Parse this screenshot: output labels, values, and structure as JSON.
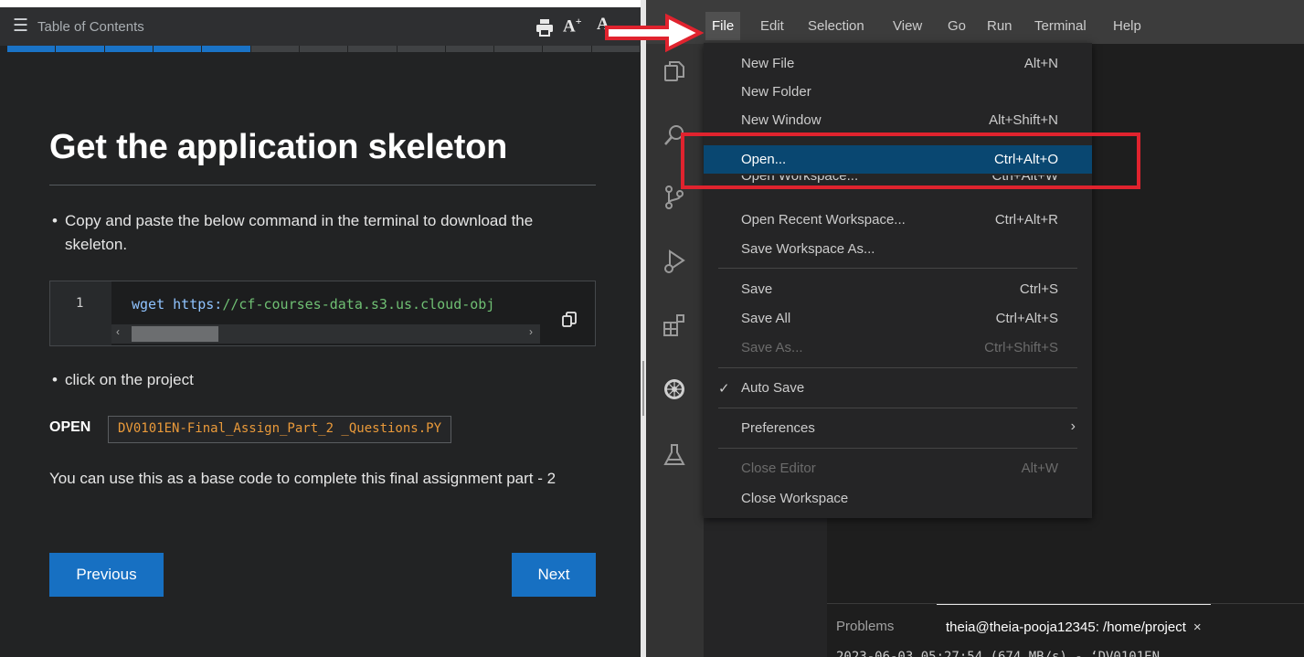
{
  "lab": {
    "toc_title": "Table of Contents",
    "font_increase": "A",
    "font_decrease": "A",
    "progress": {
      "total_segments": 13,
      "completed_segments": 5
    },
    "page_title": "Get the application skeleton",
    "bullet_1": "Copy and paste the below command in the terminal to download the skeleton.",
    "code": {
      "line_number": "1",
      "command": "wget",
      "url_scheme": "https:",
      "url_rest": "//cf-courses-data.s3.us.cloud-obj"
    },
    "bullet_2": "click on the project",
    "open_label": "OPEN",
    "open_filename": "DV0101EN-Final_Assign_Part_2 _Questions.PY",
    "description": "You can use this as a base code to complete this final assignment part - 2",
    "previous_label": "Previous",
    "next_label": "Next"
  },
  "ide": {
    "menubar": [
      "File",
      "Edit",
      "Selection",
      "View",
      "Go",
      "Run",
      "Terminal",
      "Help"
    ],
    "file_menu": {
      "new_file": {
        "label": "New File",
        "shortcut": "Alt+N"
      },
      "new_folder": {
        "label": "New Folder",
        "shortcut": ""
      },
      "new_window": {
        "label": "New Window",
        "shortcut": "Alt+Shift+N"
      },
      "open": {
        "label": "Open...",
        "shortcut": "Ctrl+Alt+O"
      },
      "open_workspace": {
        "label": "Open Workspace...",
        "shortcut": "Ctrl+Alt+W"
      },
      "open_recent": {
        "label": "Open Recent Workspace...",
        "shortcut": "Ctrl+Alt+R"
      },
      "save_workspace_as": {
        "label": "Save Workspace As...",
        "shortcut": ""
      },
      "save": {
        "label": "Save",
        "shortcut": "Ctrl+S"
      },
      "save_all": {
        "label": "Save All",
        "shortcut": "Ctrl+Alt+S"
      },
      "save_as": {
        "label": "Save As...",
        "shortcut": "Ctrl+Shift+S"
      },
      "auto_save": {
        "label": "Auto Save",
        "check": "✓"
      },
      "preferences": {
        "label": "Preferences",
        "chevron": "›"
      },
      "close_editor": {
        "label": "Close Editor",
        "shortcut": "Alt+W"
      },
      "close_workspace": {
        "label": "Close Workspace",
        "shortcut": ""
      }
    },
    "panel": {
      "problems_tab": "Problems",
      "terminal_tab": "theia@theia-pooja12345: /home/project",
      "terminal_close": "×",
      "terminal_output": "2023-06-03 05:27:54 (674 MB/s) - ‘DV0101EN"
    }
  },
  "colors": {
    "accent": "#1770c2",
    "annotation": "#e0232e",
    "menu_selected": "#094771"
  }
}
